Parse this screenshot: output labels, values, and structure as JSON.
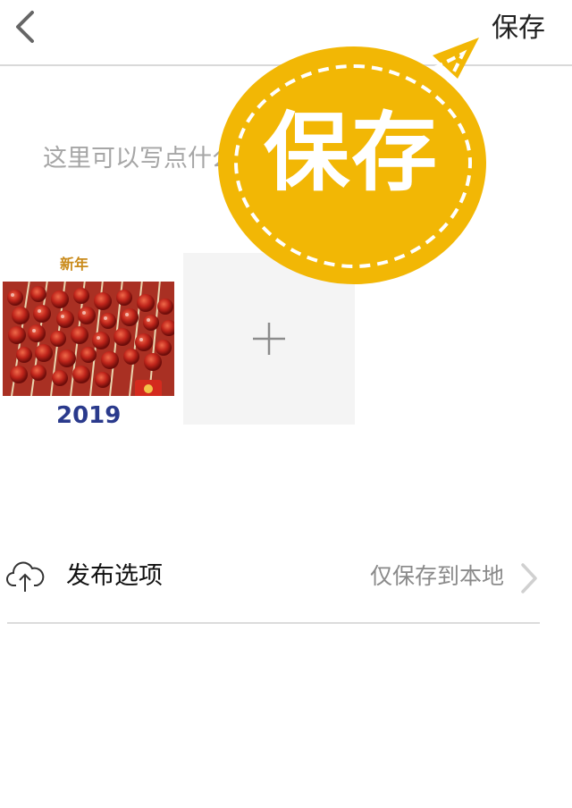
{
  "header": {
    "back_icon": "chevron-left-icon",
    "save_label": "保存"
  },
  "compose": {
    "caption_placeholder": "这里可以写点什么",
    "caption_value": ""
  },
  "photos": {
    "items": [
      {
        "description_icon": "photo-thumbnail",
        "badge_text": "新年",
        "year_text": "2019"
      }
    ],
    "add_icon": "plus-icon"
  },
  "publish": {
    "icon": "cloud-upload-icon",
    "label": "发布选项",
    "value": "仅保存到本地",
    "chevron_icon": "chevron-right-icon"
  },
  "overlay": {
    "sticker_text": "保存",
    "color": "#f2b705"
  }
}
